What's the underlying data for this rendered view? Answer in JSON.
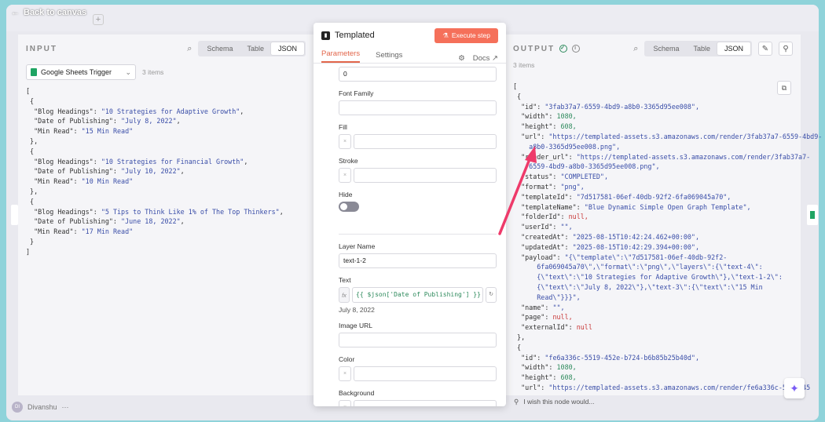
{
  "canvas": {
    "back_label": "Back to canvas"
  },
  "input": {
    "title": "INPUT",
    "view_tabs": [
      "Schema",
      "Table",
      "JSON"
    ],
    "active_tab": "JSON",
    "source_select": "Google Sheets Trigger",
    "count": "3 items",
    "items": [
      {
        "heading": "\"10 Strategies for Adaptive Growth\"",
        "date": "\"July 8, 2022\"",
        "read": "\"15 Min Read\""
      },
      {
        "heading": "\"10 Strategies for Financial Growth\"",
        "date": "\"July 10, 2022\"",
        "read": "\"10 Min Read\""
      },
      {
        "heading": "\"5 Tips to Think Like 1% of The Top Thinkers\"",
        "date": "\"June 18, 2022\"",
        "read": "\"17 Min Read\""
      }
    ],
    "keys": {
      "heading": "\"Blog Headings\":",
      "date": "\"Date of Publishing\":",
      "read": "\"Min Read\":"
    }
  },
  "node": {
    "title": "Templated",
    "execute_label": "Execute step",
    "tabs": {
      "parameters": "Parameters",
      "settings": "Settings",
      "docs": "Docs"
    },
    "top_value": "0",
    "font_family_label": "Font Family",
    "fill_label": "Fill",
    "stroke_label": "Stroke",
    "hide_label": "Hide",
    "layer_name_label": "Layer Name",
    "layer_name_value": "text-1-2",
    "text_label": "Text",
    "text_expression": "{{ $json['Date of Publishing'] }}",
    "text_preview": "July 8, 2022",
    "image_url_label": "Image URL",
    "color_label": "Color",
    "background_label": "Background",
    "swatch_x": "×",
    "fx": "fx"
  },
  "output": {
    "title": "OUTPUT",
    "view_tabs": [
      "Schema",
      "Table",
      "JSON"
    ],
    "active_tab": "JSON",
    "count": "3 items",
    "lines": [
      {
        "i": 0,
        "k": "[",
        "v": "",
        "c": ""
      },
      {
        "i": 1,
        "k": "{",
        "v": "",
        "c": ""
      },
      {
        "i": 2,
        "k": "\"id\":",
        "v": "\"3fab37a7-6559-4bd9-a8b0-3365d95ee008\",",
        "c": "s"
      },
      {
        "i": 2,
        "k": "\"width\":",
        "v": "1080,",
        "c": "n"
      },
      {
        "i": 2,
        "k": "\"height\":",
        "v": "608,",
        "c": "n"
      },
      {
        "i": 2,
        "k": "\"url\":",
        "v": "\"https://templated-assets.s3.amazonaws.com/render/3fab37a7-6559-4bd9-",
        "c": "s"
      },
      {
        "i": 4,
        "k": "",
        "v": "a8b0-3365d95ee008.png\",",
        "c": "s"
      },
      {
        "i": 2,
        "k": "\"render_url\":",
        "v": "\"https://templated-assets.s3.amazonaws.com/render/3fab37a7-",
        "c": "s"
      },
      {
        "i": 4,
        "k": "",
        "v": "6559-4bd9-a8b0-3365d95ee008.png\",",
        "c": "s"
      },
      {
        "i": 2,
        "k": "\"status\":",
        "v": "\"COMPLETED\",",
        "c": "s"
      },
      {
        "i": 2,
        "k": "\"format\":",
        "v": "\"png\",",
        "c": "s"
      },
      {
        "i": 2,
        "k": "\"templateId\":",
        "v": "\"7d517581-06ef-40db-92f2-6fa069045a70\",",
        "c": "s"
      },
      {
        "i": 2,
        "k": "\"templateName\":",
        "v": "\"Blue Dynamic Simple Open Graph Template\",",
        "c": "s"
      },
      {
        "i": 2,
        "k": "\"folderId\":",
        "v": "null,",
        "c": "nl"
      },
      {
        "i": 2,
        "k": "\"userId\":",
        "v": "\"\",",
        "c": "s"
      },
      {
        "i": 2,
        "k": "\"createdAt\":",
        "v": "\"2025-08-15T10:42:24.462+00:00\",",
        "c": "s"
      },
      {
        "i": 2,
        "k": "\"updatedAt\":",
        "v": "\"2025-08-15T10:42:29.394+00:00\",",
        "c": "s"
      },
      {
        "i": 2,
        "k": "\"payload\":",
        "v": "\"{\\\"template\\\":\\\"7d517581-06ef-40db-92f2-",
        "c": "s"
      },
      {
        "i": 6,
        "k": "",
        "v": "6fa069045a70\\\",\\\"format\\\":\\\"png\\\",\\\"layers\\\":{\\\"text-4\\\":",
        "c": "s"
      },
      {
        "i": 6,
        "k": "",
        "v": "{\\\"text\\\":\\\"10 Strategies for Adaptive Growth\\\"},\\\"text-1-2\\\":",
        "c": "s"
      },
      {
        "i": 6,
        "k": "",
        "v": "{\\\"text\\\":\\\"July 8, 2022\\\"},\\\"text-3\\\":{\\\"text\\\":\\\"15 Min",
        "c": "s"
      },
      {
        "i": 6,
        "k": "",
        "v": "Read\\\"}}}\",",
        "c": "s"
      },
      {
        "i": 2,
        "k": "\"name\":",
        "v": "\"\",",
        "c": "s"
      },
      {
        "i": 2,
        "k": "\"page\":",
        "v": "null,",
        "c": "nl"
      },
      {
        "i": 2,
        "k": "\"externalId\":",
        "v": "null",
        "c": "nl"
      },
      {
        "i": 1,
        "k": "},",
        "v": "",
        "c": ""
      },
      {
        "i": 1,
        "k": "{",
        "v": "",
        "c": ""
      },
      {
        "i": 2,
        "k": "\"id\":",
        "v": "\"fe6a336c-5519-452e-b724-b6b85b25b40d\",",
        "c": "s"
      },
      {
        "i": 2,
        "k": "\"width\":",
        "v": "1080,",
        "c": "n"
      },
      {
        "i": 2,
        "k": "\"height\":",
        "v": "608,",
        "c": "n"
      },
      {
        "i": 2,
        "k": "\"url\":",
        "v": "\"https://templated-assets.s3.amazonaws.com/render/fe6a336c-5519-45",
        "c": "s"
      }
    ]
  },
  "footer": {
    "feedback": "I wish this node would...",
    "user_name": "Divanshu",
    "user_initials": "DI"
  },
  "colors": {
    "accent": "#e2664b",
    "execute": "#f5705a",
    "string": "#3a4ea8",
    "number": "#2d8a5c",
    "null": "#c93a3a",
    "arrow": "#ee3a6a"
  }
}
